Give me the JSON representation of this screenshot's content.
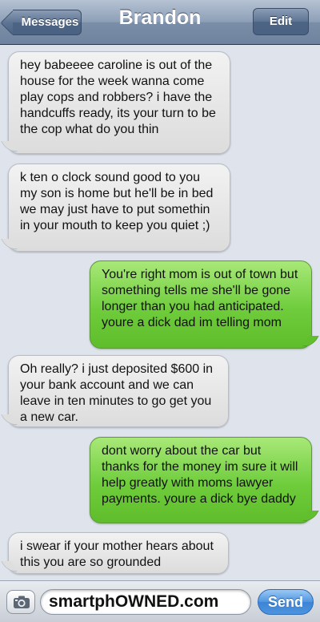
{
  "nav": {
    "back_label": "Messages",
    "title": "Brandon",
    "edit_label": "Edit"
  },
  "messages": [
    {
      "direction": "incoming",
      "text": "hey babeeee caroline is out of the house for the week wanna come play cops and robbers? i have the handcuffs ready, its your turn to be the cop what do you thin"
    },
    {
      "direction": "incoming",
      "text": "k ten o clock sound good to you my son is home but he'll be in bed we may just have to put somethin in your mouth to keep you quiet ;)"
    },
    {
      "direction": "outgoing",
      "text": "You're right mom is out of town but something tells me she'll be gone longer than you had anticipated. youre a dick dad im telling mom"
    },
    {
      "direction": "incoming",
      "text": "Oh really? i just deposited $600 in your bank account and we can leave in ten minutes to go get you a new car."
    },
    {
      "direction": "outgoing",
      "text": "dont worry about the car but thanks for the money im sure it will help greatly with moms lawyer payments. youre a dick bye daddy"
    },
    {
      "direction": "incoming",
      "text": "i swear if your mother hears about this you are so grounded"
    }
  ],
  "compose": {
    "camera_icon": "camera-icon",
    "input_value": "smartphOWNED.com",
    "send_label": "Send"
  },
  "colors": {
    "incoming_bubble": "#e6e6e6",
    "outgoing_bubble": "#6fcd3c",
    "background": "#dfe4ec",
    "send_button": "#4f95e1"
  }
}
